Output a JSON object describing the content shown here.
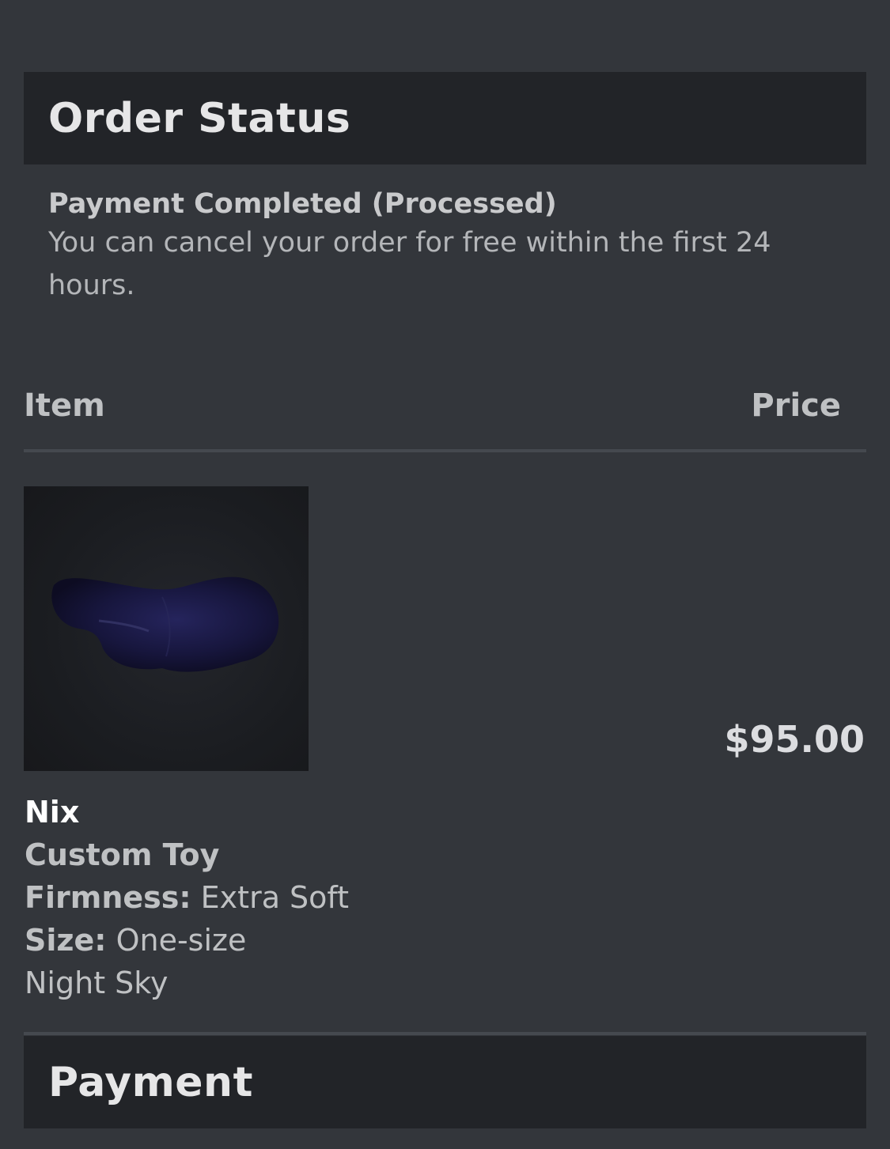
{
  "order_status": {
    "title": "Order Status",
    "status_title": "Payment Completed (Processed)",
    "status_description": "You can cancel your order for free within the first 24 hours."
  },
  "table": {
    "item_header": "Item",
    "price_header": "Price"
  },
  "product": {
    "name": "Nix",
    "type": "Custom Toy",
    "firmness_label": "Firmness:",
    "firmness_value": "Extra Soft",
    "size_label": "Size:",
    "size_value": "One-size",
    "color": "Night Sky",
    "price": "$95.00",
    "image_icon": "product-photo"
  },
  "payment": {
    "title": "Payment"
  },
  "colors": {
    "background": "#33363b",
    "header_bg": "#222428",
    "product_color": "#1f1f4a"
  }
}
